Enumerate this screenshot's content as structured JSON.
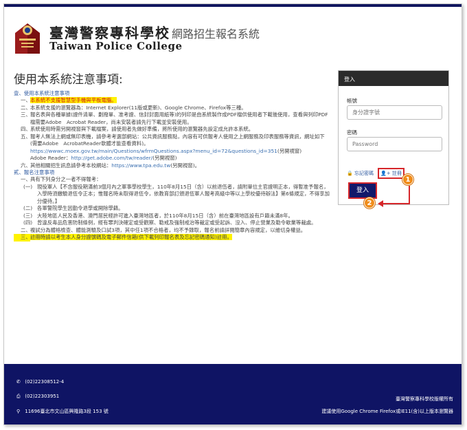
{
  "header": {
    "school_name_cn": "臺灣警察專科學校",
    "school_name_en": "Taiwan Police College",
    "system_title": "網路招生報名系統"
  },
  "notice": {
    "title": "使用本系統注意事項:",
    "section1": "壹、使用本系統注意事項",
    "section1_items": [
      {
        "num": "一、",
        "text": "本系統不支援智慧型手機與平板電腦。",
        "style": "red-highlight"
      },
      {
        "num": "二、",
        "text": "本系統支援的瀏覽器為：Internet Explorer(11版或更新)、Google Chrome、Firefox等三種。",
        "style": ""
      },
      {
        "num": "三、",
        "text": "報名表與各種單據(證件清單、劃撥單、准考證、信封封面用紙等)的列印是由系統製作成PDF檔供使用者下載後使用，查看與列印PDF檔需要Adobe　Acrobat Reader，尚未安裝者請先行下載並安裝使用。",
        "style": ""
      },
      {
        "num": "四、",
        "text": "系統使用時需另開視窗與下載檔案，請使用者先做好準備，將所使用的瀏覽器先設定成允許本系統。",
        "style": ""
      },
      {
        "num": "五、",
        "text": "報考人無法上網或無印表機，請參考考選部網站：公共資訊服務點，內容有可供報考人使用之上網服務及印表服務等資訊，網址如下(需要Adobe　AcrobatReader軟體才能查看資料)。",
        "style": ""
      }
    ],
    "link1": "https://wwwc.moex.gov.tw/main/Questions/wfrmQuestions.aspx?menu_id=72&questions_id=351",
    "link1_suffix": "(另開視窗)",
    "adobe_label": "Adobe Reader：",
    "link2": "http://get.adobe.com/tw/reader/",
    "link2_suffix": "(另開視窗)",
    "item6_num": "六、",
    "item6_text": "其他相關招生訊息請參考本校網站：",
    "link3": "https://www.tpa.edu.tw",
    "link3_suffix": "(另開視窗)。",
    "section2": "貳、報名注意事項",
    "section2_item1": {
      "num": "一、",
      "text": "具有下列身分之一者不得報考："
    },
    "sub_items": [
      {
        "num": "(一)",
        "text": "現役軍人【不含服役期滿前3個月內之軍事學校學生，110年8月15日（含）以前退伍者，請附單位主官證明正本，得暫准予報名，入學時須繳驗退伍令正本；惟報名時未取得退伍令，依教育部訂頒退伍軍人報考高級中等以上學校優待辦法】第6條規定，不得享加分優待。】"
      },
      {
        "num": "(二)",
        "text": "各軍警院學生因勤令退學或開除學籍。"
      },
      {
        "num": "(三)",
        "text": "大陸地區人民及香港、澳門居民經許可進入臺灣地區者，於110年8月15日（含）前在臺灣地區設有戶籍未滿8年。"
      },
      {
        "num": "(四)",
        "text": "曾違反毒品危害防制條例，經有罪判決確定或受觀察、勒戒及強制戒治等裁定或受起訴、沒入、停止營業及勒令歇業等裁處。"
      }
    ],
    "section2_item2": {
      "num": "二、",
      "text": "複試分為體格檢查、體能測驗及口試3項，其中任1項不合格者，均不予錄取，報名前請詳閱簡章內容規定，以維切身權益。"
    },
    "section2_item3": {
      "num": "三、",
      "text": "註冊時請以考生本人身分證號碼及電子郵件信箱(供下載列印報名表及忘記密碼通知)註冊。"
    }
  },
  "login": {
    "header": "登入",
    "account_label": "帳號",
    "account_placeholder": "身分證字號",
    "password_label": "密碼",
    "password_placeholder": "Password",
    "forgot_password": "忘記密碼",
    "register": "註冊",
    "login_button": "登入",
    "badge1": "1",
    "badge2": "2"
  },
  "footer": {
    "phone": "(02)22308512-4",
    "fax": "(02)22303951",
    "address": "11696臺北市文山區興隆路3段 153 號",
    "copyright": "臺灣警察專科學校版權所有",
    "browser_note": "建議使用Google Chrome Firefox或IE11(含)以上版本瀏覽器"
  },
  "colors": {
    "navy": "#0f1464",
    "accent_red": "#d6262a",
    "badge_orange": "#f08c1a",
    "highlight": "#fff200"
  }
}
